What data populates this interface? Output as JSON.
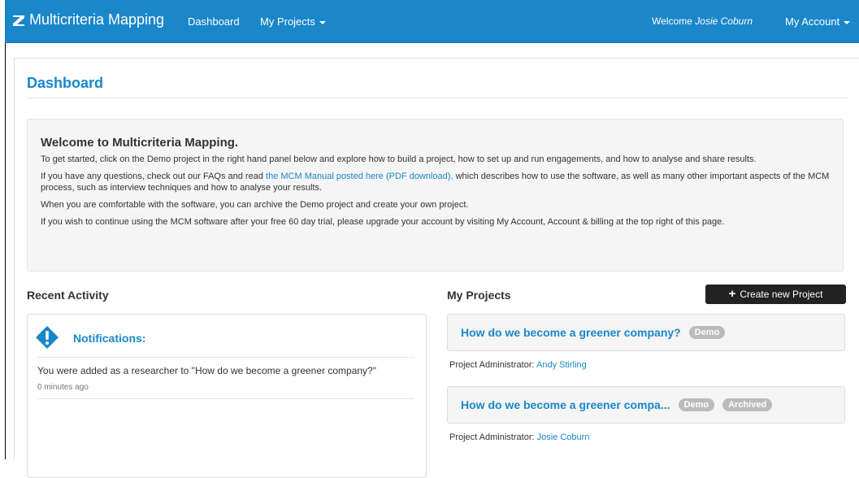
{
  "nav": {
    "brand": "Multicriteria Mapping",
    "dashboard": "Dashboard",
    "my_projects": "My Projects",
    "welcome_prefix": "Welcome",
    "user_name": "Josie Coburn",
    "my_account": "My Account"
  },
  "page": {
    "title": "Dashboard"
  },
  "welcome": {
    "heading_prefix": "Welcome to",
    "heading_brand": "Multicriteria Mapping.",
    "p1": "To get started, click on the Demo project in the right hand panel below and explore how to build a project, how to set up and run engagements, and how to analyse and share results.",
    "p2_before": "If you have any questions, check out our FAQs and read",
    "p2_link": "the MCM Manual posted here (PDF download),",
    "p2_after": "which describes how to use the software, as well as many other important aspects of the MCM process, such as interview techniques and how to analyse your results.",
    "p3": "When you are comfortable with the software, you can archive the Demo project and create your own project.",
    "p4": "If you wish to continue using the MCM software after your free 60 day trial, please upgrade your account by visiting My Account, Account & billing at the top right of this page."
  },
  "recent": {
    "heading": "Recent Activity",
    "notifications_title": "Notifications:",
    "item_text": "You were added as a researcher to \"How do we become a greener company?\"",
    "item_time": "0 minutes ago"
  },
  "projects": {
    "heading": "My Projects",
    "create_label": "Create new Project",
    "admin_label": "Project Administrator:",
    "items": [
      {
        "title": "How do we become a greener company?",
        "badges": [
          "Demo"
        ],
        "admin": "Andy Stirling"
      },
      {
        "title": "How do we become a greener compa...",
        "badges": [
          "Demo",
          "Archived"
        ],
        "admin": "Josie Coburn"
      }
    ]
  },
  "colors": {
    "brand": "#1a87c9",
    "badge": "#bbbbbb",
    "button": "#222222"
  },
  "icons": [
    "logo-icon",
    "caret-down-icon",
    "plus-icon",
    "exclamation-diamond-icon"
  ]
}
